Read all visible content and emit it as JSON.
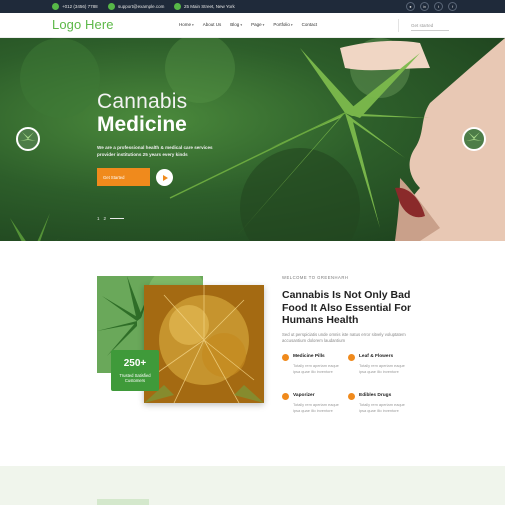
{
  "topbar": {
    "phone": "+012 (3456) 7788",
    "email": "support@example.com",
    "address": "25 Main Street, New York",
    "social_icons": [
      "user-icon",
      "linkedin-icon",
      "twitter-icon",
      "facebook-icon"
    ]
  },
  "header": {
    "logo": "Logo Here",
    "nav": [
      {
        "label": "Home",
        "has_dropdown": true
      },
      {
        "label": "About Us",
        "has_dropdown": false
      },
      {
        "label": "Blog",
        "has_dropdown": true
      },
      {
        "label": "Page",
        "has_dropdown": true
      },
      {
        "label": "Portfolio",
        "has_dropdown": true
      },
      {
        "label": "Contact",
        "has_dropdown": false
      }
    ],
    "cta": "Get started"
  },
  "hero": {
    "title_line1": "Cannabis",
    "title_line2": "Medicine",
    "subtitle": "We are a professional health & medical care services provider institutions 25 years every kinds",
    "button": "Get Started",
    "slide_current": "1",
    "slide_next": "2"
  },
  "about": {
    "badge_number": "250+",
    "badge_text": "Trusted Satisfied Customers",
    "eyebrow": "WELCOME TO GREENHARH",
    "title": "Cannabis Is Not Only Bad Food It Also Essential For Humans Health",
    "description": "Sed ut perspiciatis unde omnis iste natus error sitvely voluptatem accusantium dolorem laudantium",
    "features": [
      {
        "title": "Medicine Pills",
        "desc": "Totally rem aperiam eaque ipsa quae illo inventore"
      },
      {
        "title": "Leaf & Flowers",
        "desc": "Totally rem aperiam eaque ipsa quae illo inventore"
      },
      {
        "title": "Vaporizer",
        "desc": "Totally rem aperiam eaque ipsa quae illo inventore"
      },
      {
        "title": "Edibles Drugs",
        "desc": "Totally rem aperiam eaque ipsa quae illo inventore"
      }
    ]
  },
  "colors": {
    "accent_green": "#5cb848",
    "accent_orange": "#f08a1c",
    "topbar_bg": "#1f2a3a"
  }
}
